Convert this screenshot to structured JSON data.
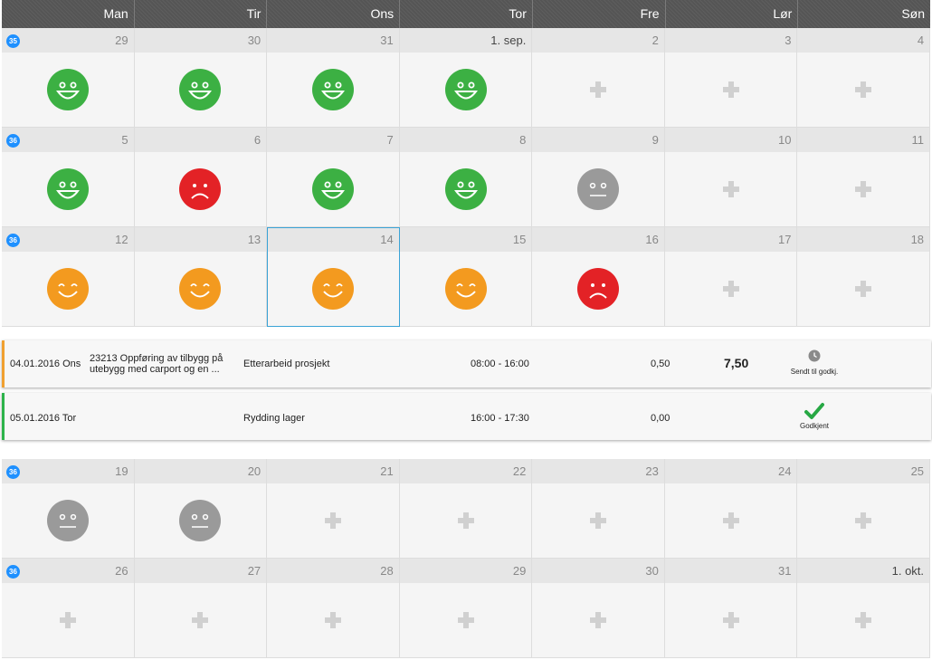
{
  "header": {
    "days": [
      "Man",
      "Tir",
      "Ons",
      "Tor",
      "Fre",
      "Lør",
      "Søn"
    ]
  },
  "colors": {
    "happy_green": "#3cb043",
    "happy_orange": "#f39a1f",
    "sad_red": "#e32226",
    "neutral_gray": "#9a9a9a",
    "badge_blue": "#1e90ff"
  },
  "weeks": [
    {
      "badge": "35",
      "days": [
        {
          "label": "29",
          "mood": "happy-green"
        },
        {
          "label": "30",
          "mood": "happy-green"
        },
        {
          "label": "31",
          "mood": "happy-green"
        },
        {
          "label": "1. sep.",
          "mood": "happy-green"
        },
        {
          "label": "2",
          "mood": "add"
        },
        {
          "label": "3",
          "mood": "add"
        },
        {
          "label": "4",
          "mood": "add"
        }
      ]
    },
    {
      "badge": "36",
      "days": [
        {
          "label": "5",
          "mood": "happy-green"
        },
        {
          "label": "6",
          "mood": "sad-red"
        },
        {
          "label": "7",
          "mood": "happy-green"
        },
        {
          "label": "8",
          "mood": "happy-green"
        },
        {
          "label": "9",
          "mood": "neutral-gray"
        },
        {
          "label": "10",
          "mood": "add"
        },
        {
          "label": "11",
          "mood": "add"
        }
      ]
    },
    {
      "badge": "36",
      "days": [
        {
          "label": "12",
          "mood": "smile-orange"
        },
        {
          "label": "13",
          "mood": "smile-orange"
        },
        {
          "label": "14",
          "mood": "smile-orange"
        },
        {
          "label": "15",
          "mood": "smile-orange"
        },
        {
          "label": "16",
          "mood": "sad-red"
        },
        {
          "label": "17",
          "mood": "add"
        },
        {
          "label": "18",
          "mood": "add"
        }
      ]
    },
    {
      "badge": "36",
      "days": [
        {
          "label": "19",
          "mood": "neutral-gray"
        },
        {
          "label": "20",
          "mood": "neutral-gray"
        },
        {
          "label": "21",
          "mood": "add"
        },
        {
          "label": "22",
          "mood": "add"
        },
        {
          "label": "23",
          "mood": "add"
        },
        {
          "label": "24",
          "mood": "add"
        },
        {
          "label": "25",
          "mood": "add"
        }
      ]
    },
    {
      "badge": "36",
      "days": [
        {
          "label": "26",
          "mood": "add"
        },
        {
          "label": "27",
          "mood": "add"
        },
        {
          "label": "28",
          "mood": "add"
        },
        {
          "label": "29",
          "mood": "add"
        },
        {
          "label": "30",
          "mood": "add"
        },
        {
          "label": "31",
          "mood": "add"
        },
        {
          "label": "1. okt.",
          "mood": "add"
        }
      ]
    }
  ],
  "entries": [
    {
      "date": "04.01.2016 Ons",
      "project": "23213 Oppføring av tilbygg på utebygg med carport og en ...",
      "activity": "Etterarbeid prosjekt",
      "time": "08:00 - 16:00",
      "extra": "0,50",
      "total": "7,50",
      "status": "Sendt til godkj.",
      "status_icon": "clock-icon"
    },
    {
      "date": "05.01.2016 Tor",
      "project": "",
      "activity": "Rydding lager",
      "time": "16:00 - 17:30",
      "extra": "0,00",
      "total": "",
      "status": "Godkjent",
      "status_icon": "checkmark-icon"
    }
  ]
}
